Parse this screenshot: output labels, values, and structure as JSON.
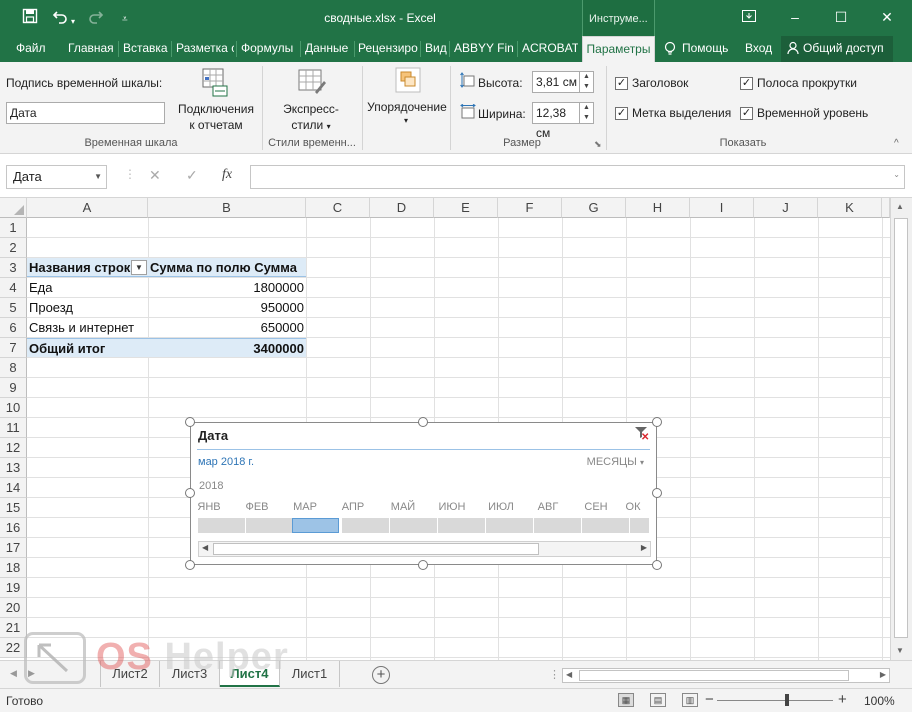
{
  "window": {
    "title": "сводные.xlsx - Excel",
    "context_tab": "Инструме...",
    "icons": [
      "save-icon",
      "undo-icon",
      "redo-icon",
      "customize-qat-icon",
      "ribbon-display-icon",
      "minimize-icon",
      "maximize-icon",
      "close-icon"
    ]
  },
  "tabs": [
    {
      "label": "Файл"
    },
    {
      "label": "Главная"
    },
    {
      "label": "Вставка"
    },
    {
      "label": "Разметка с"
    },
    {
      "label": "Формулы"
    },
    {
      "label": "Данные"
    },
    {
      "label": "Рецензиро"
    },
    {
      "label": "Вид"
    },
    {
      "label": "ABBYY Fin"
    },
    {
      "label": "ACROBAT"
    },
    {
      "label": "Параметры"
    },
    {
      "label": "Помощь"
    },
    {
      "label": "Вход"
    },
    {
      "label": "Общий доступ"
    }
  ],
  "ribbon": {
    "timeline_caption_label": "Подпись временной шкалы:",
    "timeline_caption_value": "Дата",
    "connections_label_1": "Подключения",
    "connections_label_2": "к отчетам",
    "group_timeline": "Временная шкала",
    "express_label_1": "Экспресс-",
    "express_label_2": "стили",
    "group_styles": "Стили временн...",
    "arrange_label": "Упорядочение",
    "height_label": "Высота:",
    "height_value": "3,81 см",
    "width_label": "Ширина:",
    "width_value": "12,38 см",
    "group_size": "Размер",
    "show": [
      {
        "label": "Заголовок",
        "checked": true
      },
      {
        "label": "Метка выделения",
        "checked": true
      },
      {
        "label": "Полоса прокрутки",
        "checked": true
      },
      {
        "label": "Временной уровень",
        "checked": true
      }
    ],
    "group_show": "Показать"
  },
  "formula_bar": {
    "name_box": "Дата",
    "fx": "fx",
    "formula": ""
  },
  "grid": {
    "columns": [
      "A",
      "B",
      "C",
      "D",
      "E",
      "F",
      "G",
      "H",
      "I",
      "J",
      "K"
    ],
    "rows": [
      "1",
      "2",
      "3",
      "4",
      "5",
      "6",
      "7",
      "8",
      "9",
      "10",
      "11",
      "12",
      "13",
      "14",
      "15",
      "16",
      "17",
      "18",
      "19",
      "20",
      "21",
      "22"
    ]
  },
  "pivot": {
    "header_rows": "Названия строк",
    "header_sum": "Сумма по полю Сумма",
    "rows": [
      {
        "label": "Еда",
        "value": "1800000"
      },
      {
        "label": "Проезд",
        "value": "950000"
      },
      {
        "label": "Связь и интернет",
        "value": "650000"
      }
    ],
    "total_label": "Общий итог",
    "total_value": "3400000"
  },
  "timeline": {
    "title": "Дата",
    "selection": "мар 2018 г.",
    "level": "МЕСЯЦЫ",
    "year": "2018",
    "months": [
      "ЯНВ",
      "ФЕВ",
      "МАР",
      "АПР",
      "МАЙ",
      "ИЮН",
      "ИЮЛ",
      "АВГ",
      "СЕН",
      "ОК"
    ],
    "selected_month": 2
  },
  "sheets": {
    "tabs": [
      "Лист2",
      "Лист3",
      "Лист4",
      "Лист1"
    ],
    "active": "Лист4",
    "add": "+"
  },
  "status": {
    "ready": "Готово",
    "zoom": "100%"
  },
  "watermark": {
    "text_a": "OS",
    "text_b": " Helper"
  },
  "colors": {
    "brand_green": "#217346",
    "pivot_header_bg": "#ddebf7",
    "timeline_selected": "#9dc3e6"
  }
}
